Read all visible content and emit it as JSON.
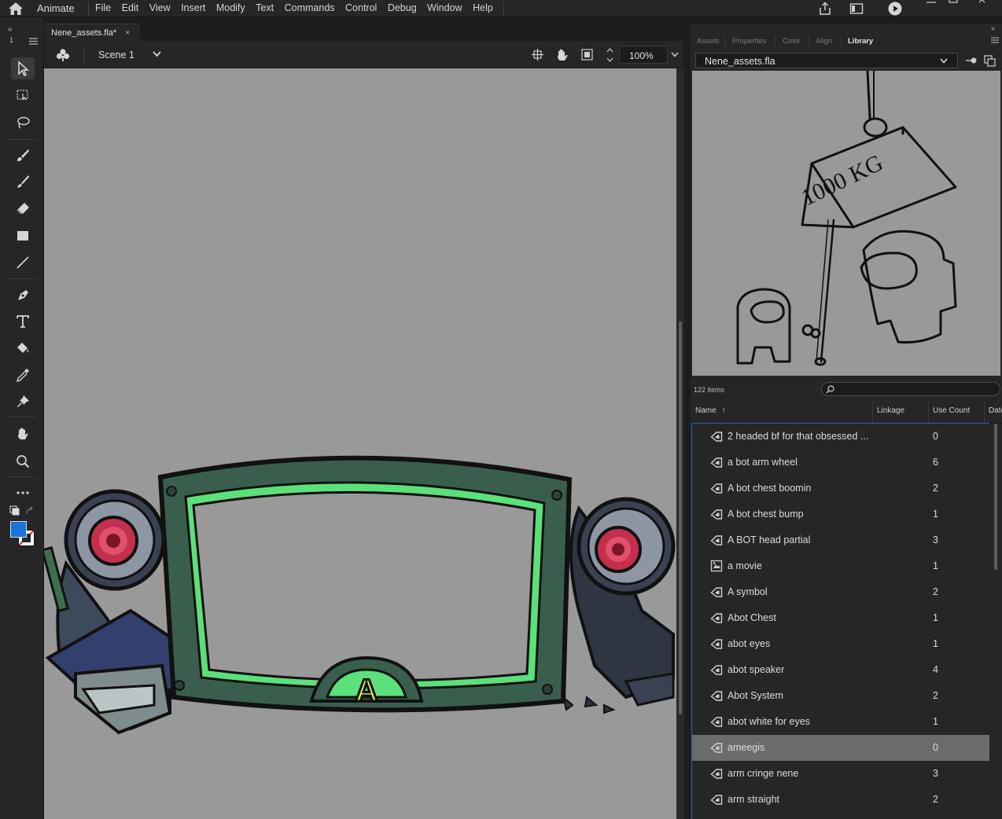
{
  "app": {
    "name": "Animate",
    "menu": [
      "File",
      "Edit",
      "View",
      "Insert",
      "Modify",
      "Text",
      "Commands",
      "Control",
      "Debug",
      "Window",
      "Help"
    ]
  },
  "document": {
    "tab_label": "Nene_assets.fla*",
    "close_glyph": "×",
    "scene_label": "Scene 1",
    "zoom": "100%"
  },
  "colors": {
    "fill_color": "#1a73d9",
    "stroke_color": "#ffffff",
    "stage_bg": "#999999",
    "selection_row": "#6b6b6b"
  },
  "panel": {
    "tabs": [
      "Assets",
      "Properties",
      "Color",
      "Align",
      "Library"
    ],
    "active_tab": "Library",
    "library_file": "Nene_assets.fla",
    "items_count": "122 items",
    "columns": [
      "Name",
      "Linkage",
      "Use Count",
      "Date"
    ],
    "sort_glyph": "↑",
    "preview_text": "1000 KG"
  },
  "library_items": [
    {
      "name": "2 headed bf for that obsessed ...",
      "count": "0",
      "icon": "symbol-icon"
    },
    {
      "name": "a bot arm wheel",
      "count": "6",
      "icon": "symbol-icon"
    },
    {
      "name": "A bot chest boomin",
      "count": "2",
      "icon": "symbol-icon"
    },
    {
      "name": "A bot chest bump",
      "count": "1",
      "icon": "symbol-icon"
    },
    {
      "name": "A BOT head partial",
      "count": "3",
      "icon": "symbol-icon"
    },
    {
      "name": "a movie",
      "count": "1",
      "icon": "movieclip-icon"
    },
    {
      "name": "A symbol",
      "count": "2",
      "icon": "symbol-icon"
    },
    {
      "name": "Abot Chest",
      "count": "1",
      "icon": "symbol-icon"
    },
    {
      "name": "abot eyes",
      "count": "1",
      "icon": "symbol-icon"
    },
    {
      "name": "abot speaker",
      "count": "4",
      "icon": "symbol-icon"
    },
    {
      "name": "Abot System",
      "count": "2",
      "icon": "symbol-icon"
    },
    {
      "name": "abot white for eyes",
      "count": "1",
      "icon": "symbol-icon"
    },
    {
      "name": "ameegis",
      "count": "0",
      "icon": "symbol-icon",
      "selected": true
    },
    {
      "name": "arm cringe nene",
      "count": "3",
      "icon": "symbol-icon"
    },
    {
      "name": "arm straight",
      "count": "2",
      "icon": "symbol-icon"
    },
    {
      "name": "",
      "count": "",
      "icon": "symbol-icon"
    }
  ],
  "stage_art": {
    "emblem_letter": "A"
  },
  "toolbar": {
    "tools": [
      "selection-tool-icon",
      "free-transform-tool-icon",
      "lasso-tool-icon",
      "paint-brush-tool-icon",
      "brush-tool-icon",
      "eraser-tool-icon",
      "rectangle-tool-icon",
      "line-tool-icon",
      "pen-tool-icon",
      "text-tool-icon",
      "paint-bucket-tool-icon",
      "eyedropper-tool-icon",
      "pin-tool-icon",
      "hand-tool-icon",
      "zoom-tool-icon",
      "more-tools-icon"
    ],
    "collapse_glyph": "«",
    "frame_number": "1"
  }
}
